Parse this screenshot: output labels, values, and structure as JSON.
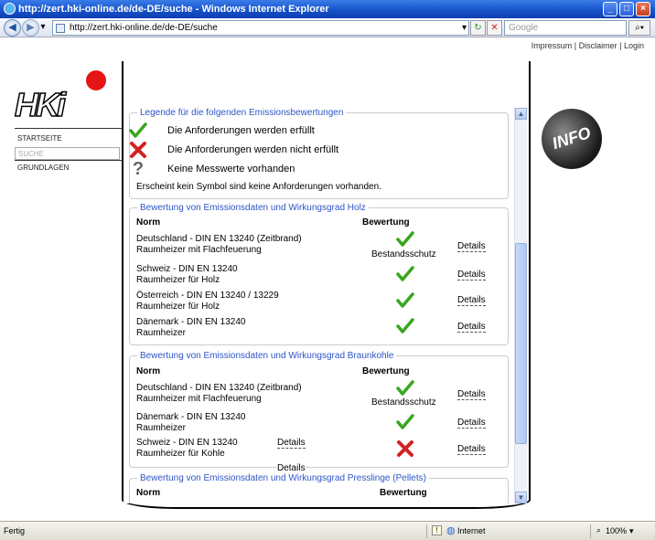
{
  "window": {
    "title": "http://zert.hki-online.de/de-DE/suche - Windows Internet Explorer"
  },
  "browser": {
    "url": "http://zert.hki-online.de/de-DE/suche",
    "search_placeholder": "Google",
    "status": "Fertig",
    "zone": "Internet",
    "zoom": "100%"
  },
  "top_links": {
    "impressum": "Impressum",
    "sep": "|",
    "disclaimer": "Disclaimer",
    "login": "Login"
  },
  "logo": {
    "text": "HKi"
  },
  "info_badge": "INFO",
  "nav": [
    {
      "label": "STARTSEITE",
      "active": false
    },
    {
      "label": "SUCHE",
      "active": true
    },
    {
      "label": "GRUNDLAGEN",
      "active": false
    }
  ],
  "legend": {
    "title": "Legende für die folgenden Emissionsbewertungen",
    "items": [
      {
        "icon": "check",
        "text": "Die Anforderungen werden erfüllt"
      },
      {
        "icon": "cross",
        "text": "Die Anforderungen werden nicht erfüllt"
      },
      {
        "icon": "question",
        "text": "Keine Messwerte vorhanden"
      }
    ],
    "note": "Erscheint kein Symbol sind keine Anforderungen vorhanden."
  },
  "sections": [
    {
      "title": "Bewertung von Emissionsdaten und Wirkungsgrad Holz",
      "col_norm": "Norm",
      "col_rating": "Bewertung",
      "rows": [
        {
          "line1": "Deutschland - DIN EN 13240 (Zeitbrand)",
          "line2": "Raumheizer mit Flachfeuerung",
          "rating": "check",
          "extra": "Bestandsschutz",
          "details": "Details"
        },
        {
          "line1": "Schweiz - DIN EN 13240",
          "line2": "Raumheizer für Holz",
          "rating": "check",
          "extra": "",
          "details": "Details"
        },
        {
          "line1": "Österreich - DIN EN 13240 / 13229",
          "line2": "Raumheizer für Holz",
          "rating": "check",
          "extra": "",
          "details": "Details"
        },
        {
          "line1": "Dänemark - DIN EN 13240",
          "line2": "Raumheizer",
          "rating": "check",
          "extra": "",
          "details": "Details"
        }
      ]
    },
    {
      "title": "Bewertung von Emissionsdaten und Wirkungsgrad Braunkohle",
      "col_norm": "Norm",
      "col_rating": "Bewertung",
      "rows": [
        {
          "line1": "Deutschland - DIN EN 13240 (Zeitbrand)",
          "line2": "Raumheizer mit Flachfeuerung",
          "rating": "check",
          "extra": "Bestandsschutz",
          "details": "Details"
        },
        {
          "line1": "Dänemark - DIN EN 13240",
          "line2": "Raumheizer",
          "rating": "check",
          "extra": "",
          "details": "Details"
        },
        {
          "line1": "Schweiz - DIN EN 13240",
          "line2": "Raumheizer für Kohle",
          "rating": "cross",
          "extra": "",
          "details": "Details",
          "details_left": "Details",
          "details_below": "Details"
        }
      ]
    },
    {
      "title": "Bewertung von Emissionsdaten und Wirkungsgrad Presslinge (Pellets)",
      "col_norm": "Norm",
      "col_rating": "Bewertung"
    }
  ],
  "colors": {
    "legend_blue": "#2e54c8",
    "check_green": "#3aa61c",
    "cross_red": "#d22222"
  }
}
